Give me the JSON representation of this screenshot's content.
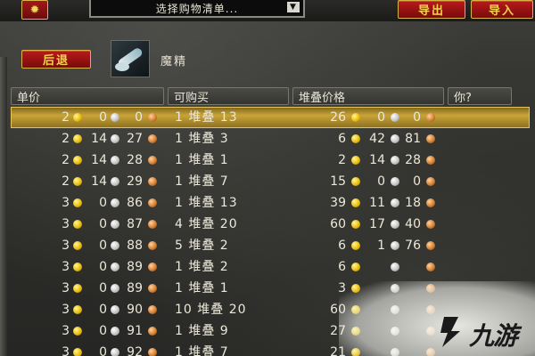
{
  "topbar": {
    "dropdown_label": "选择购物清单...",
    "dropdown_arrow": "▼",
    "export_label": "导出",
    "import_label": "导入",
    "gear_glyph": "✹"
  },
  "item": {
    "back_label": "后退",
    "name": "魔精"
  },
  "columns": {
    "unit_price": "单价",
    "available": "可购买",
    "stack_price": "堆叠价格",
    "you": "你?"
  },
  "rows": [
    {
      "g": "2",
      "s": "0",
      "c": "0",
      "qty": "1 堆叠 13",
      "sg": "26",
      "ss": "0",
      "sc": "0",
      "selected": true
    },
    {
      "g": "2",
      "s": "14",
      "c": "27",
      "qty": "1 堆叠 3",
      "sg": "6",
      "ss": "42",
      "sc": "81"
    },
    {
      "g": "2",
      "s": "14",
      "c": "28",
      "qty": "1 堆叠 1",
      "sg": "2",
      "ss": "14",
      "sc": "28"
    },
    {
      "g": "2",
      "s": "14",
      "c": "29",
      "qty": "1 堆叠 7",
      "sg": "15",
      "ss": "0",
      "sc": "0"
    },
    {
      "g": "3",
      "s": "0",
      "c": "86",
      "qty": "1 堆叠 13",
      "sg": "39",
      "ss": "11",
      "sc": "18"
    },
    {
      "g": "3",
      "s": "0",
      "c": "87",
      "qty": "4 堆叠 20",
      "sg": "60",
      "ss": "17",
      "sc": "40"
    },
    {
      "g": "3",
      "s": "0",
      "c": "88",
      "qty": "5 堆叠 2",
      "sg": "6",
      "ss": "1",
      "sc": "76"
    },
    {
      "g": "3",
      "s": "0",
      "c": "89",
      "qty": "1 堆叠 2",
      "sg": "6",
      "ss": "",
      "sc": ""
    },
    {
      "g": "3",
      "s": "0",
      "c": "89",
      "qty": "1 堆叠 1",
      "sg": "3",
      "ss": "",
      "sc": ""
    },
    {
      "g": "3",
      "s": "0",
      "c": "90",
      "qty": "10 堆叠 20",
      "sg": "60",
      "ss": "",
      "sc": ""
    },
    {
      "g": "3",
      "s": "0",
      "c": "91",
      "qty": "1 堆叠 9",
      "sg": "27",
      "ss": "",
      "sc": ""
    },
    {
      "g": "3",
      "s": "0",
      "c": "92",
      "qty": "1 堆叠 7",
      "sg": "21",
      "ss": "",
      "sc": ""
    }
  ],
  "watermark": {
    "text": "九游"
  },
  "colors": {
    "selected_row": "#c9a436",
    "button_red": "#b81b1b",
    "button_text": "#f5d24e",
    "gold_coin": "#e6b800",
    "silver_coin": "#c0c0c0",
    "copper_coin": "#d07a2a"
  },
  "icons": {
    "gold": "gold-coin-icon",
    "silver": "silver-coin-icon",
    "copper": "copper-coin-icon",
    "item": "item-icon",
    "gear": "gear-icon",
    "dropdown": "chevron-down-icon",
    "watermark": "jiuyou-logo-icon"
  }
}
